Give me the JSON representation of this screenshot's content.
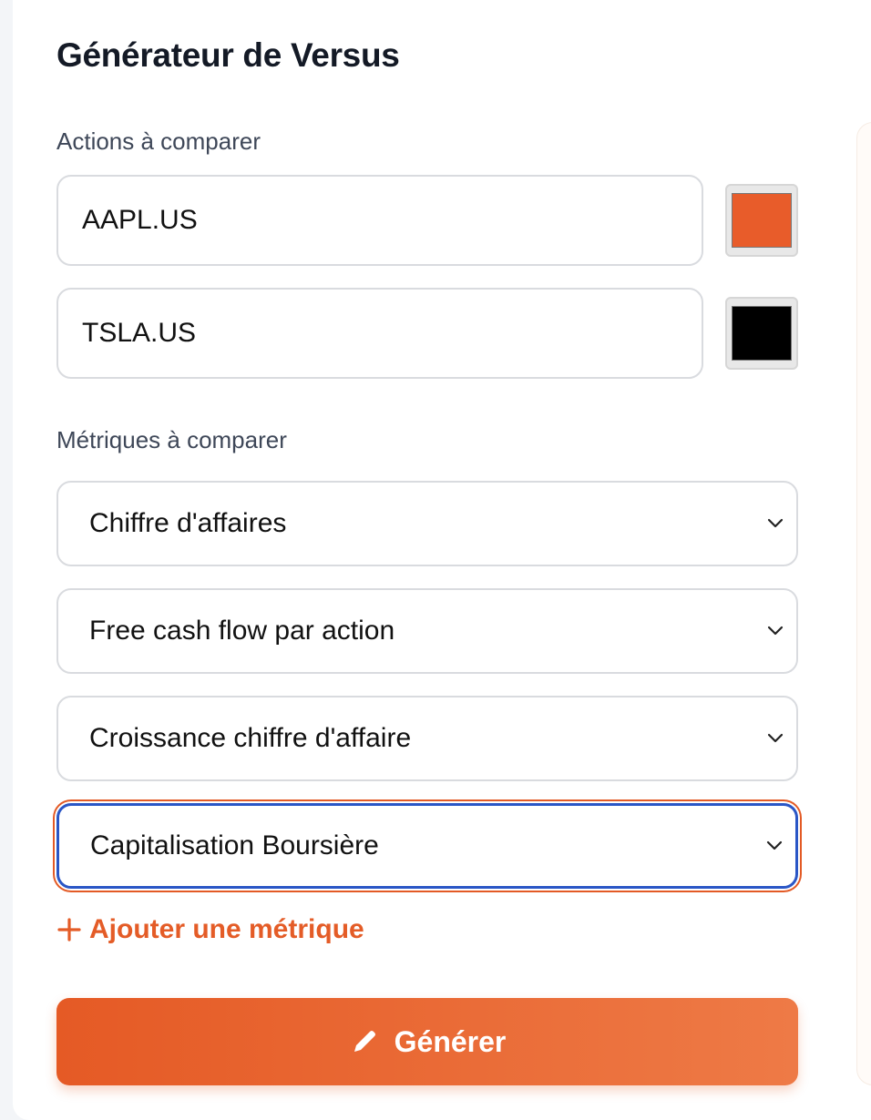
{
  "title": "Générateur de Versus",
  "stocks_section": {
    "label": "Actions à comparer",
    "items": [
      {
        "ticker": "AAPL.US",
        "color": "#e85c2a"
      },
      {
        "ticker": "TSLA.US",
        "color": "#000000"
      }
    ]
  },
  "metrics_section": {
    "label": "Métriques à comparer",
    "items": [
      {
        "value": "Chiffre d'affaires"
      },
      {
        "value": "Free cash flow par action"
      },
      {
        "value": "Croissance chiffre d'affaire"
      },
      {
        "value": "Capitalisation Boursière",
        "focused": true
      }
    ],
    "add_label": "Ajouter une métrique"
  },
  "generate_button": {
    "label": "Générer",
    "icon": "pencil-icon"
  },
  "colors": {
    "accent": "#e55a25",
    "focus_ring": "#2a56c6",
    "title": "#141a26"
  }
}
